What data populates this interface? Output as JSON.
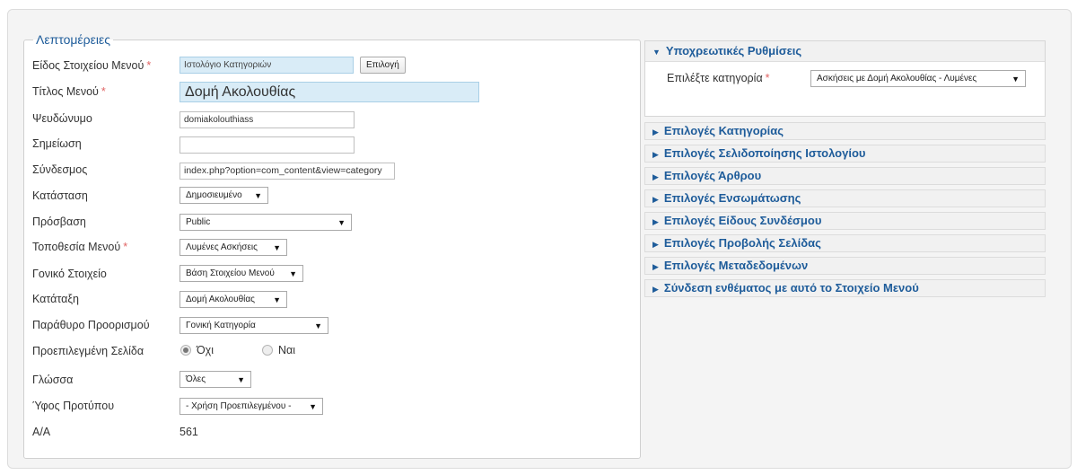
{
  "details": {
    "legend": "Λεπτομέρειες",
    "item_type": {
      "label": "Είδος Στοιχείου Μενού",
      "value": "Ιστολόγιο Κατηγοριών",
      "button": "Επιλογή"
    },
    "menu_title": {
      "label": "Τίτλος Μενού",
      "value": "Δομή Ακολουθίας"
    },
    "alias": {
      "label": "Ψευδώνυμο",
      "value": "domiakolouthiass"
    },
    "note": {
      "label": "Σημείωση",
      "value": ""
    },
    "link": {
      "label": "Σύνδεσμος",
      "value": "index.php?option=com_content&view=category"
    },
    "status": {
      "label": "Κατάσταση",
      "value": "Δημοσιευμένο"
    },
    "access": {
      "label": "Πρόσβαση",
      "value": "Public"
    },
    "menu_location": {
      "label": "Τοποθεσία Μενού",
      "value": "Λυμένες Ασκήσεις"
    },
    "parent_item": {
      "label": "Γονικό Στοιχείο",
      "value": "Βάση Στοιχείου Μενού"
    },
    "ordering": {
      "label": "Κατάταξη",
      "value": "Δομή Ακολουθίας"
    },
    "target_window": {
      "label": "Παράθυρο Προορισμού",
      "value": "Γονική Κατηγορία"
    },
    "default_page": {
      "label": "Προεπιλεγμένη Σελίδα",
      "no": "Όχι",
      "yes": "Ναι",
      "selected": "no"
    },
    "language": {
      "label": "Γλώσσα",
      "value": "Όλες"
    },
    "template_style": {
      "label": "Ύφος Προτύπου",
      "value": "- Χρήση Προεπιλεγμένου -"
    },
    "id": {
      "label": "Α/Α",
      "value": "561"
    },
    "required_mark": "*"
  },
  "required_settings": {
    "title": "Υποχρεωτικές Ρυθμίσεις",
    "category_label": "Επιλέξτε κατηγορία",
    "category_value": "Ασκήσεις με Δομή Ακολουθίας - Λυμένες"
  },
  "accordion": [
    "Επιλογές Κατηγορίας",
    "Επιλογές Σελιδοποίησης Ιστολογίου",
    "Επιλογές Άρθρου",
    "Επιλογές Ενσωμάτωσης",
    "Επιλογές Είδους Συνδέσμου",
    "Επιλογές Προβολής Σελίδας",
    "Επιλογές Μεταδεδομένων",
    "Σύνδεση ενθέματος με αυτό το Στοιχείο Μενού"
  ],
  "colors": {
    "accent": "#1e5c9a",
    "required": "#e06464",
    "readonly_bg": "#d9ecf7"
  },
  "icons": {
    "collapsed": "triangle-right-icon",
    "expanded": "triangle-down-icon",
    "dropdown": "dropdown-arrow-icon"
  }
}
